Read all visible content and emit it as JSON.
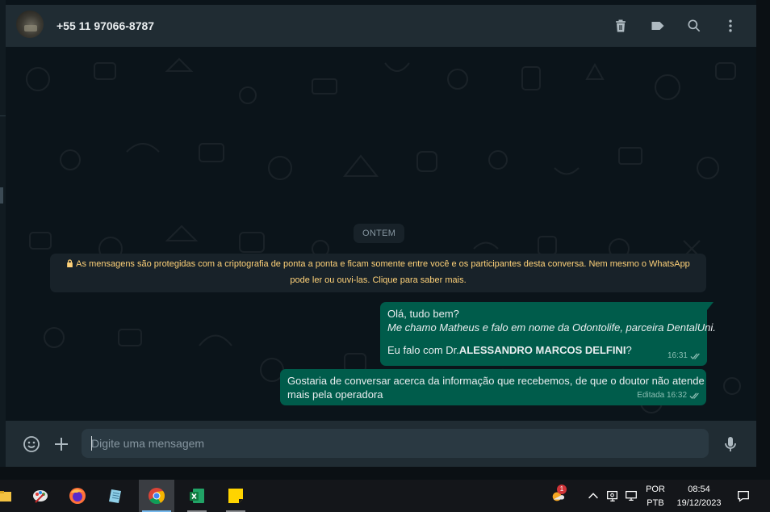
{
  "header": {
    "contact_name": "+55 11 97066-8787"
  },
  "chat": {
    "date_label": "ONTEM",
    "encryption_notice": {
      "line1": "As mensagens são protegidas com a criptografia de ponta a ponta e ficam somente entre você e os participantes desta conversa. Nem mesmo o WhatsApp",
      "line2": "pode ler ou ouvi-las. Clique para saber mais."
    },
    "messages": [
      {
        "line1": "Olá, tudo bem?",
        "line2": "Me chamo Matheus e falo em nome da Odontolife, parceira DentalUni.",
        "line3_prefix": "Eu falo com Dr.",
        "line3_bold": "ALESSANDRO MARCOS DELFINI",
        "line3_suffix": "?",
        "time": "16:31",
        "status": "delivered"
      },
      {
        "line1": "Gostaria de conversar acerca da informação que recebemos, de que o doutor não atende",
        "line2": "mais pela operadora",
        "time": "Editada 16:32",
        "status": "delivered"
      }
    ]
  },
  "composer": {
    "placeholder": "Digite uma mensagem"
  },
  "taskbar": {
    "lang_top": "POR",
    "lang_bottom": "PTB",
    "time": "08:54",
    "date": "19/12/2023",
    "notification_count": "1"
  },
  "colors": {
    "outgoing_bubble": "#005c4b",
    "panel": "#202c33",
    "background": "#0b141a",
    "notice_text": "#ffd279"
  }
}
